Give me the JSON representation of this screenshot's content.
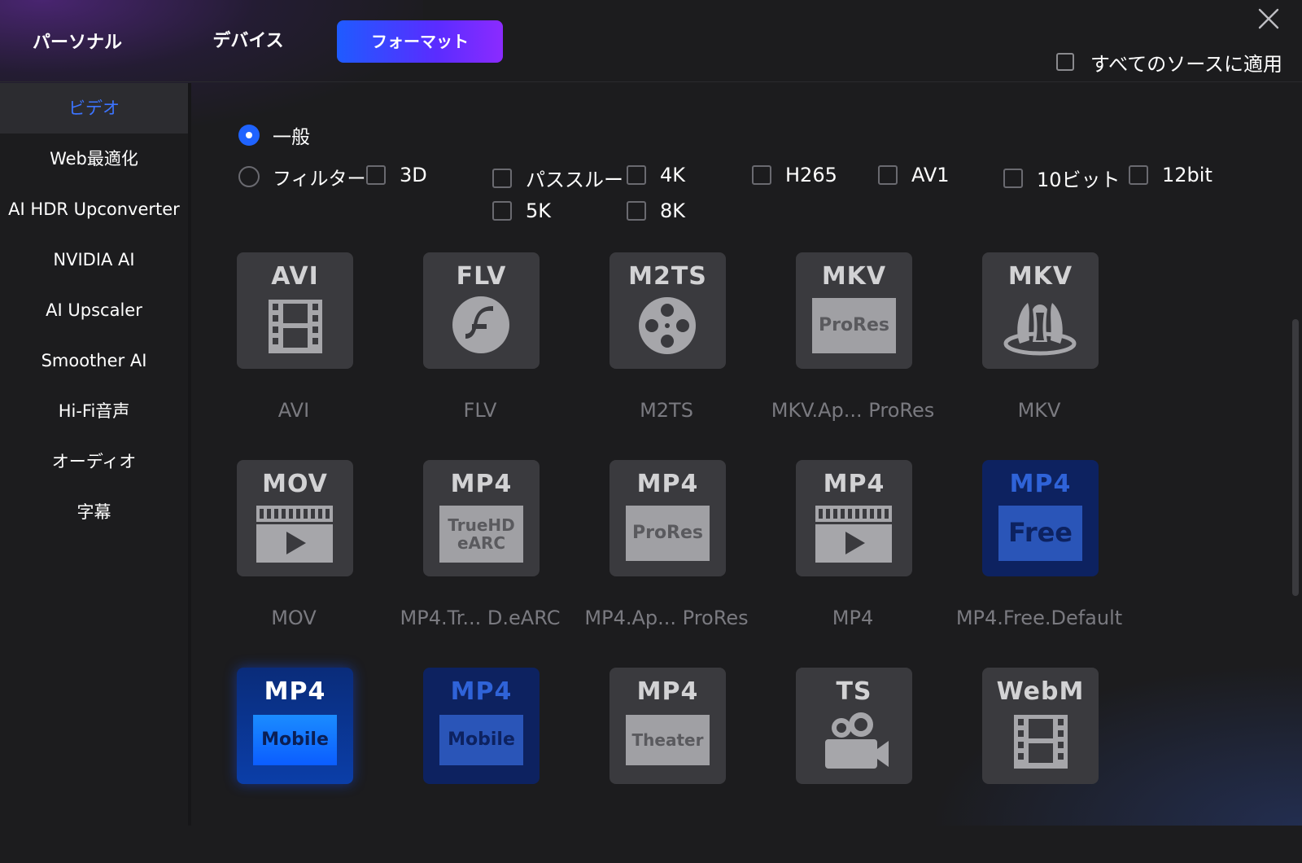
{
  "header": {
    "tabs": [
      {
        "label": "パーソナル",
        "active": false
      },
      {
        "label": "デバイス",
        "active": false
      },
      {
        "label": "フォーマット",
        "active": true
      }
    ],
    "apply_all_label": "すべてのソースに適用",
    "apply_all_checked": false
  },
  "sidebar": {
    "items": [
      {
        "label": "ビデオ",
        "active": true
      },
      {
        "label": "Web最適化"
      },
      {
        "label": "AI HDR Upconverter"
      },
      {
        "label": "NVIDIA AI"
      },
      {
        "label": "AI Upscaler"
      },
      {
        "label": "Smoother AI"
      },
      {
        "label": "Hi-Fi音声"
      },
      {
        "label": "オーディオ"
      },
      {
        "label": "字幕"
      }
    ]
  },
  "filters": {
    "general_label": "一般",
    "general_selected": true,
    "filter_label": "フィルター",
    "options": [
      "3D",
      "パススルー",
      "4K",
      "H265",
      "AV1",
      "10ビット",
      "12bit",
      "5K",
      "8K"
    ]
  },
  "formats": [
    {
      "icon_title": "AVI",
      "badge": "",
      "glyph": "film-icon",
      "caption": "AVI",
      "style": "gray"
    },
    {
      "icon_title": "FLV",
      "badge": "",
      "glyph": "flash-icon",
      "caption": "FLV",
      "style": "gray"
    },
    {
      "icon_title": "M2TS",
      "badge": "",
      "glyph": "reel-icon",
      "caption": "M2TS",
      "style": "gray"
    },
    {
      "icon_title": "MKV",
      "badge": "ProRes",
      "glyph": "",
      "caption": "MKV.Ap... ProRes",
      "style": "gray"
    },
    {
      "icon_title": "MKV",
      "badge": "",
      "glyph": "matroska-icon",
      "caption": "MKV",
      "style": "gray"
    },
    {
      "icon_title": "MOV",
      "badge": "",
      "glyph": "clapper-play-icon",
      "caption": "MOV",
      "style": "gray"
    },
    {
      "icon_title": "MP4",
      "badge": "TrueHD eARC",
      "glyph": "",
      "caption": "MP4.Tr... D.eARC",
      "style": "gray"
    },
    {
      "icon_title": "MP4",
      "badge": "ProRes",
      "glyph": "",
      "caption": "MP4.Ap... ProRes",
      "style": "gray"
    },
    {
      "icon_title": "MP4",
      "badge": "",
      "glyph": "clapper-play-icon",
      "caption": "MP4",
      "style": "gray"
    },
    {
      "icon_title": "MP4",
      "badge": "Free",
      "glyph": "",
      "caption": "MP4.Free.Default",
      "style": "blue-dim"
    },
    {
      "icon_title": "MP4",
      "badge": "Mobile",
      "glyph": "",
      "caption": "",
      "style": "blue-bright"
    },
    {
      "icon_title": "MP4",
      "badge": "Mobile",
      "glyph": "",
      "caption": "",
      "style": "blue-dim"
    },
    {
      "icon_title": "MP4",
      "badge": "Theater",
      "glyph": "",
      "caption": "",
      "style": "gray"
    },
    {
      "icon_title": "TS",
      "badge": "",
      "glyph": "camera-icon",
      "caption": "",
      "style": "gray"
    },
    {
      "icon_title": "WebM",
      "badge": "",
      "glyph": "film-icon",
      "caption": "",
      "style": "gray"
    }
  ],
  "colors": {
    "accent": "#1f63ff",
    "tab_gradient_start": "#1f5bff",
    "tab_gradient_end": "#8b2bff",
    "active_sidebar_text": "#3c74ff"
  }
}
